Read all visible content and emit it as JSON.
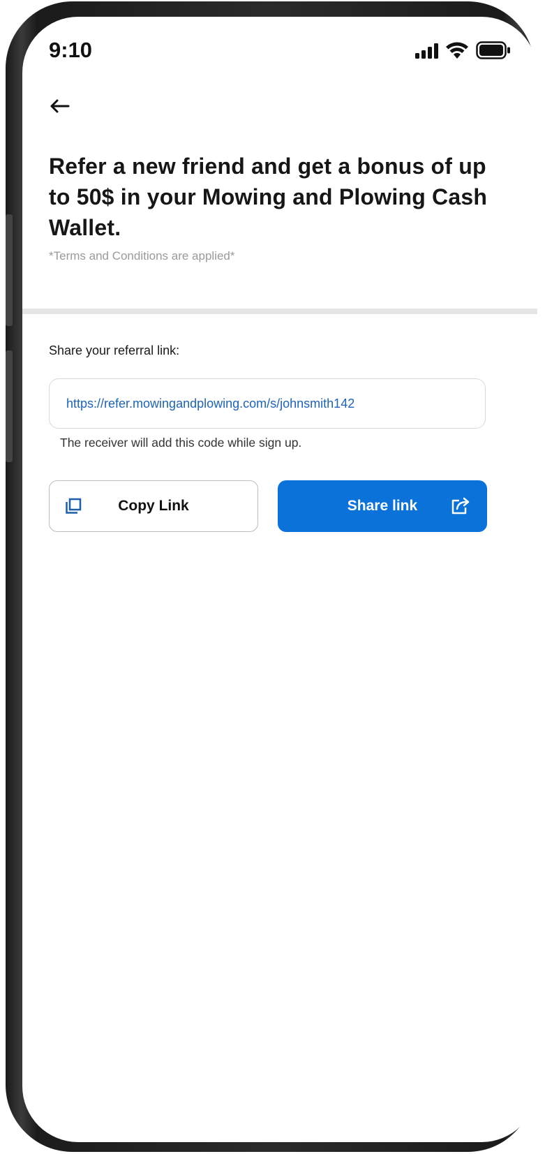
{
  "status_bar": {
    "time": "9:10",
    "icons": [
      "signal-icon",
      "wifi-icon",
      "battery-icon"
    ]
  },
  "nav": {
    "back_icon": "arrow-left-icon"
  },
  "content": {
    "headline": "Refer a new friend and get a bonus of up to 50$ in your Mowing and Plowing Cash Wallet.",
    "terms": "*Terms and Conditions are applied*",
    "share_label": "Share your referral link:",
    "referral_link": "https://refer.mowingandplowing.com/s/johnsmith142",
    "helper_text": "The receiver will add this code while sign up."
  },
  "actions": {
    "copy_label": "Copy Link",
    "copy_icon": "copy-icon",
    "share_label": "Share link",
    "share_icon": "share-icon"
  },
  "colors": {
    "primary": "#0a72d9",
    "link": "#1d63b8",
    "terms_gray": "#9a9a9a",
    "divider": "#e5e5e5"
  }
}
